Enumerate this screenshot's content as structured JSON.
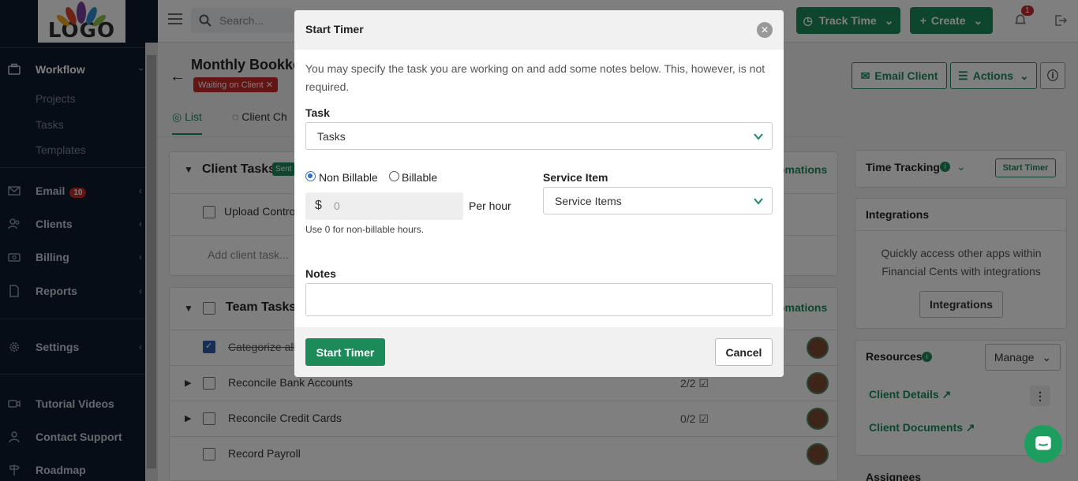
{
  "colors": {
    "brand_green": "#1d8a5a",
    "sidebar_bg": "#0f1b2d",
    "danger": "#c62828"
  },
  "logo": {
    "text": "LOGO"
  },
  "sidebar": {
    "workflow": "Workflow",
    "workflow_sub": [
      "Projects",
      "Tasks",
      "Templates"
    ],
    "email": "Email",
    "email_badge": "10",
    "clients": "Clients",
    "billing": "Billing",
    "reports": "Reports",
    "settings": "Settings",
    "tutorial": "Tutorial Videos",
    "contact": "Contact Support",
    "roadmap": "Roadmap"
  },
  "topbar": {
    "search_placeholder": "Search...",
    "track_time": "Track Time",
    "create": "Create",
    "notif_count": "1"
  },
  "project": {
    "title": "Monthly Bookke",
    "status": "Waiting on Client",
    "tabs": [
      "List",
      "Client Ch"
    ],
    "email_client": "Email Client",
    "actions": "Actions"
  },
  "client_tasks": {
    "title": "Client Tasks",
    "sent_badge": "Sent",
    "automations": "omations",
    "rows": [
      "Upload Contro"
    ],
    "add": "Add client task..."
  },
  "team_tasks": {
    "title": "Team Tasks",
    "automations": "omations",
    "rows": [
      {
        "label": "Categorize all",
        "done": true,
        "count": ""
      },
      {
        "label": "Reconcile Bank Accounts",
        "done": false,
        "count": "2/2"
      },
      {
        "label": "Reconcile Credit Cards",
        "done": false,
        "count": "0/2"
      },
      {
        "label": "Record Payroll",
        "done": false,
        "count": ""
      }
    ]
  },
  "right": {
    "time_tracking": "Time Tracking",
    "start_timer": "Start Timer",
    "integrations_title": "Integrations",
    "integrations_text": "Quickly access other apps within Financial Cents with integrations",
    "integrations_btn": "Integrations",
    "resources": "Resources",
    "manage": "Manage",
    "client_details": "Client Details",
    "client_documents": "Client Documents",
    "assignees": "Assignees"
  },
  "modal": {
    "title": "Start Timer",
    "intro": "You may specify the task you are working on and add some notes below. This, however, is not required.",
    "task_label": "Task",
    "task_value": "Tasks",
    "non_billable": "Non Billable",
    "billable": "Billable",
    "currency": "$",
    "rate_value": "0",
    "per_hour": "Per hour",
    "help": "Use 0 for non-billable hours.",
    "service_label": "Service Item",
    "service_value": "Service Items",
    "notes_label": "Notes",
    "start_btn": "Start Timer",
    "cancel_btn": "Cancel"
  }
}
